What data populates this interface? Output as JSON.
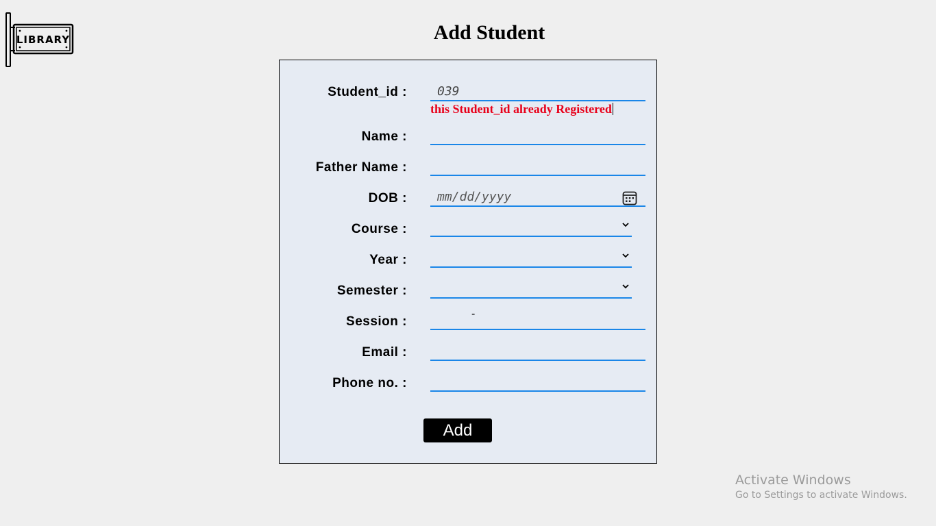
{
  "page": {
    "title": "Add Student",
    "logo_text": "LIBRARY"
  },
  "form": {
    "student_id": {
      "label": "Student_id :",
      "value": "039",
      "error": "this Student_id already Registered"
    },
    "name": {
      "label": "Name :",
      "value": ""
    },
    "father_name": {
      "label": "Father Name :",
      "value": ""
    },
    "dob": {
      "label": "DOB :",
      "placeholder": "mm/dd/yyyy"
    },
    "course": {
      "label": "Course :",
      "value": ""
    },
    "year": {
      "label": "Year :",
      "value": ""
    },
    "semester": {
      "label": "Semester :",
      "value": ""
    },
    "session": {
      "label": "Session :",
      "separator": "-"
    },
    "email": {
      "label": "Email :",
      "value": ""
    },
    "phone": {
      "label": "Phone no. :",
      "value": ""
    },
    "submit_label": "Add"
  },
  "watermark": {
    "title": "Activate Windows",
    "subtitle": "Go to Settings to activate Windows."
  },
  "colors": {
    "field_underline": "#1a86e8",
    "error": "#e8001a",
    "form_bg": "#e6ebf3"
  }
}
